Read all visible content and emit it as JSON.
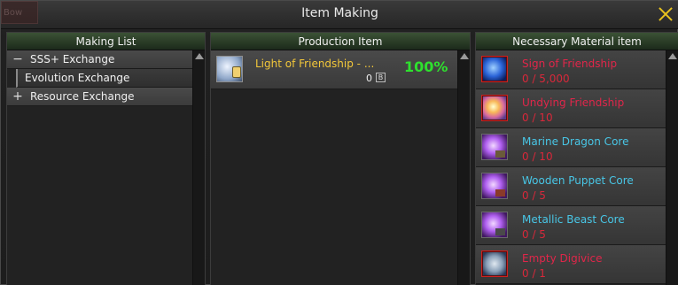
{
  "window": {
    "title": "Item Making",
    "ghost_button_label": "Bow"
  },
  "making_list": {
    "header": "Making List",
    "items": [
      {
        "sign": "−",
        "label": "SSS+ Exchange"
      },
      {
        "label": "Evolution Exchange"
      },
      {
        "sign": "+",
        "label": "Resource Exchange"
      }
    ]
  },
  "production": {
    "header": "Production Item",
    "item": {
      "name": "Light of Friendship - ...",
      "percent": "100%",
      "count": "0",
      "bind_badge": "B",
      "icon": "light-of-friendship-icon"
    }
  },
  "materials": {
    "header": "Necessary Material item",
    "items": [
      {
        "name": "Sign of Friendship",
        "qty": "0 / 5,000",
        "name_color": "red",
        "icon": "sign-of-friendship-icon"
      },
      {
        "name": "Undying Friendship",
        "qty": "0 / 10",
        "name_color": "red",
        "icon": "undying-friendship-icon"
      },
      {
        "name": "Marine Dragon Core",
        "qty": "0 / 10",
        "name_color": "cyan",
        "icon": "marine-dragon-core-icon"
      },
      {
        "name": "Wooden Puppet Core",
        "qty": "0 / 5",
        "name_color": "cyan",
        "icon": "wooden-puppet-core-icon"
      },
      {
        "name": "Metallic Beast Core",
        "qty": "0 / 5",
        "name_color": "cyan",
        "icon": "metallic-beast-core-icon"
      },
      {
        "name": "Empty Digivice",
        "qty": "0 / 1",
        "name_color": "red",
        "icon": "empty-digivice-icon"
      }
    ]
  },
  "colors": {
    "accent_yellow": "#f2c73a",
    "percent_green": "#2ee02e",
    "missing_red": "#e0264a",
    "core_cyan": "#48c6e6"
  }
}
